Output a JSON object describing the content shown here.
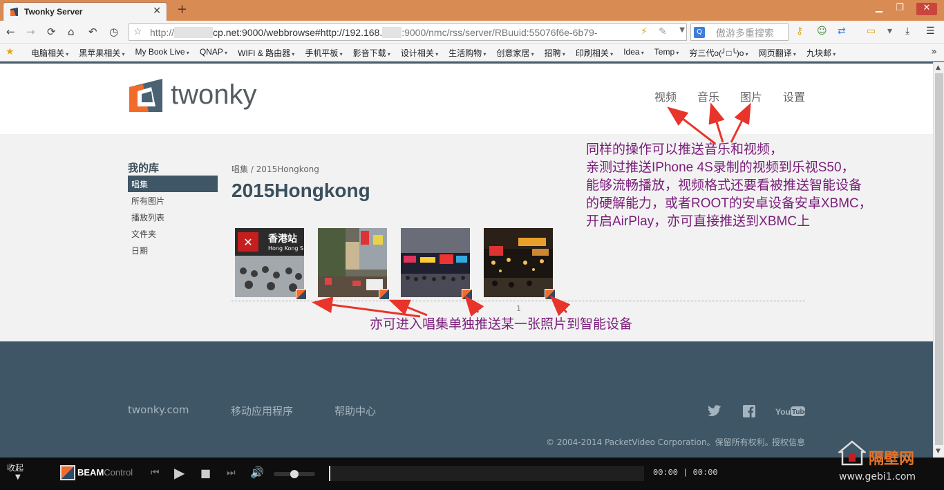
{
  "browser": {
    "tab_title": "Twonky Server",
    "new_tab": "+",
    "url_prefix": "http://",
    "url_rest": "cp.net:9000/webbrowse#http://192.168.",
    "url_tail": ":9000/nmc/rss/server/RBuuid:55076f6e-6b79-",
    "search_placeholder": "傲游多重搜索",
    "bookmarks": [
      "电脑相关",
      "黑苹果相关",
      "My Book Live",
      "QNAP",
      "WIFI & 路由器",
      "手机平板",
      "影音下载",
      "设计相关",
      "生活购物",
      "创意家居",
      "招聘",
      "印刷相关",
      "Idea",
      "Temp",
      "穷三代o(╯□╰)o",
      "网页翻译",
      "九块邮"
    ]
  },
  "site": {
    "logo": "twonky",
    "nav": [
      "视频",
      "音乐",
      "图片",
      "设置"
    ],
    "library_title": "我的库",
    "sidebar": [
      "唱集",
      "所有图片",
      "播放列表",
      "文件夹",
      "日期"
    ],
    "breadcrumb": "唱集 / 2015Hongkong",
    "album_title": "2015Hongkong",
    "page_number": "1",
    "thumbs": [
      "Hong Kong station",
      "Street market",
      "Mong Kok street",
      "Night street"
    ],
    "thumb_sign": "香港站",
    "thumb_sign_en": "Hong Kong S"
  },
  "annotations": {
    "top_lines": [
      "同样的操作可以推送音乐和视频，",
      "亲测过推送IPhone 4S录制的视频到乐视S50，",
      "能够流畅播放，视频格式还要看被推送智能设备",
      "的硬解能力，或者ROOT的安卓设备安卓XBMC，",
      "开启AirPlay，亦可直接推送到XBMC上"
    ],
    "bottom": "亦可进入唱集单独推送某一张照片到智能设备",
    "color": "#7a1d7a"
  },
  "footer": {
    "links": [
      "twonky.com",
      "移动应用程序",
      "帮助中心"
    ],
    "social": [
      "twitter-icon",
      "facebook-icon",
      "youtube-icon"
    ],
    "youtube": "YouTube",
    "copyright": "© 2004-2014 PacketVideo Corporation。保留所有权利。",
    "license": "授权信息"
  },
  "beam": {
    "collapse_label": "收起",
    "name": "BEAM",
    "subname": "Control",
    "time": "00:00 | 00:00",
    "volume": 0.5
  },
  "watermark": {
    "cn": "隔壁网",
    "url": "www.gebi1.com"
  },
  "colors": {
    "accent": "#f26b2b",
    "footer_bg": "#3f5666",
    "arrow": "#e8342a",
    "titlebar": "#d98b54"
  }
}
